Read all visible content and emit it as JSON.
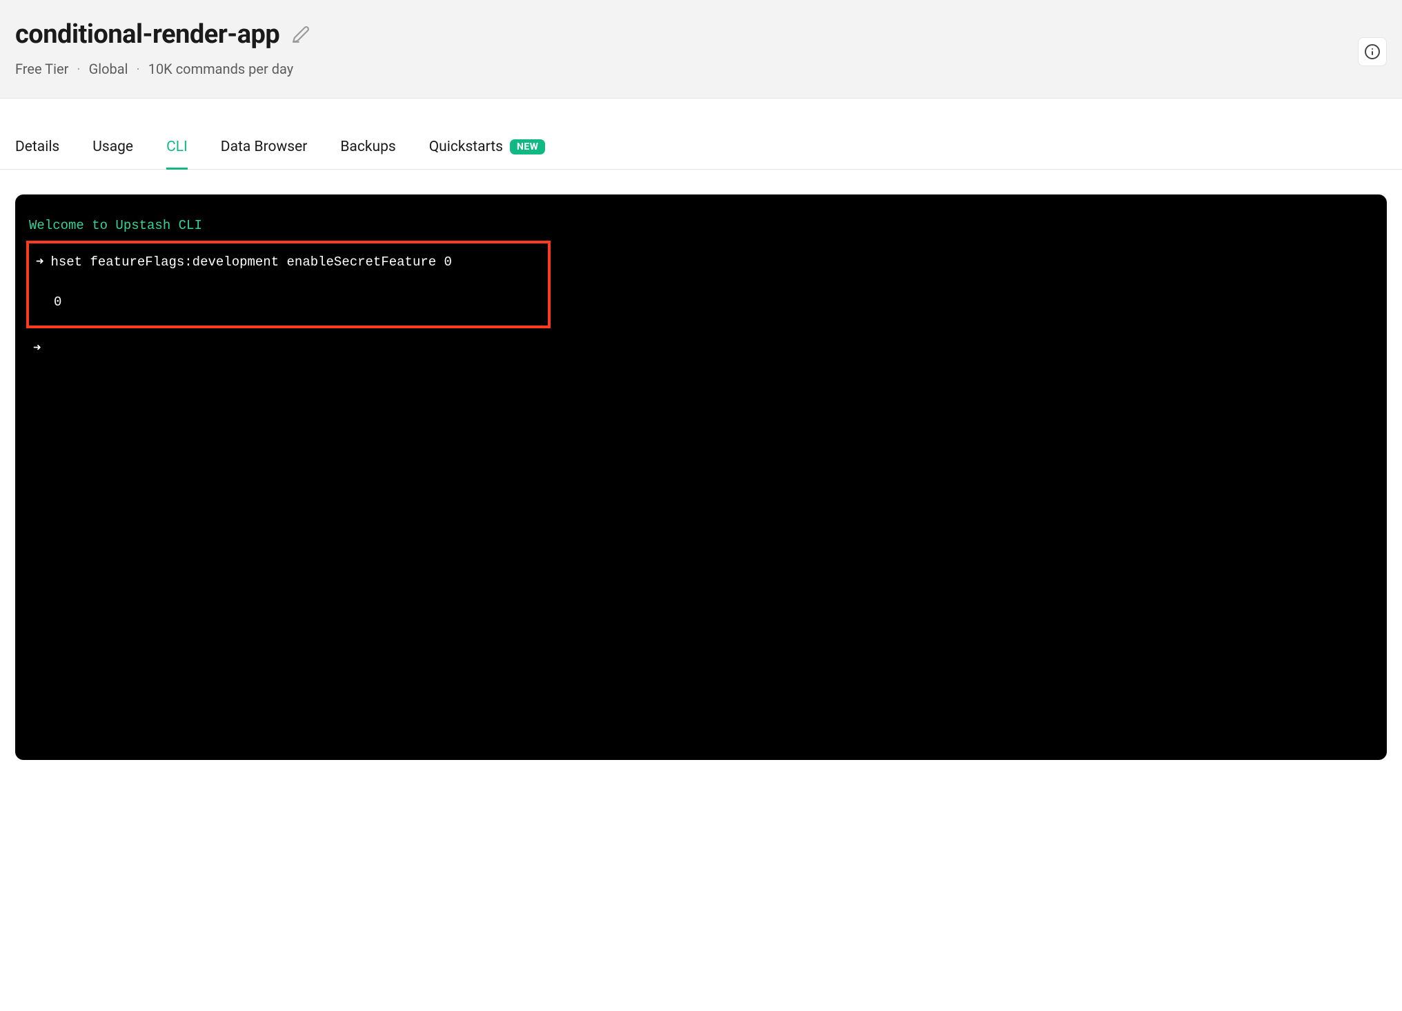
{
  "header": {
    "title": "conditional-render-app",
    "meta": {
      "tier": "Free Tier",
      "region": "Global",
      "limit": "10K commands per day"
    }
  },
  "tabs": [
    {
      "label": "Details",
      "active": false
    },
    {
      "label": "Usage",
      "active": false
    },
    {
      "label": "CLI",
      "active": true
    },
    {
      "label": "Data Browser",
      "active": false
    },
    {
      "label": "Backups",
      "active": false
    },
    {
      "label": "Quickstarts",
      "active": false,
      "badge": "NEW"
    }
  ],
  "terminal": {
    "welcome": "Welcome to Upstash CLI",
    "prompt_arrow": "➜",
    "command": "hset featureFlags:development enableSecretFeature 0",
    "output": "0"
  }
}
